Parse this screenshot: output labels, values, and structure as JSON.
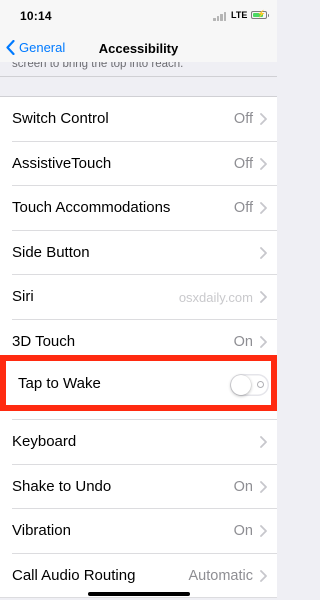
{
  "status_bar": {
    "time": "10:14",
    "network": "LTE",
    "battery_level": 0.85,
    "battery_color": "#4cd964"
  },
  "nav": {
    "back_label": "General",
    "back_icon": "chevron-left-icon",
    "title": "Accessibility",
    "accent_color": "#007aff"
  },
  "section_footer": "screen to bring the top into reach.",
  "rows": [
    {
      "label": "Switch Control",
      "value": "Off"
    },
    {
      "label": "AssistiveTouch",
      "value": "Off"
    },
    {
      "label": "Touch Accommodations",
      "value": "Off"
    },
    {
      "label": "Side Button",
      "value": ""
    },
    {
      "label": "Siri",
      "value": "osxdaily.com"
    },
    {
      "label": "3D Touch",
      "value": "On"
    },
    {
      "label": "Tap to Wake",
      "toggle": false
    },
    {
      "label": "Keyboard",
      "value": ""
    },
    {
      "label": "Shake to Undo",
      "value": "On"
    },
    {
      "label": "Vibration",
      "value": "On"
    },
    {
      "label": "Call Audio Routing",
      "value": "Automatic"
    }
  ],
  "highlight_color": "#ff2a10"
}
